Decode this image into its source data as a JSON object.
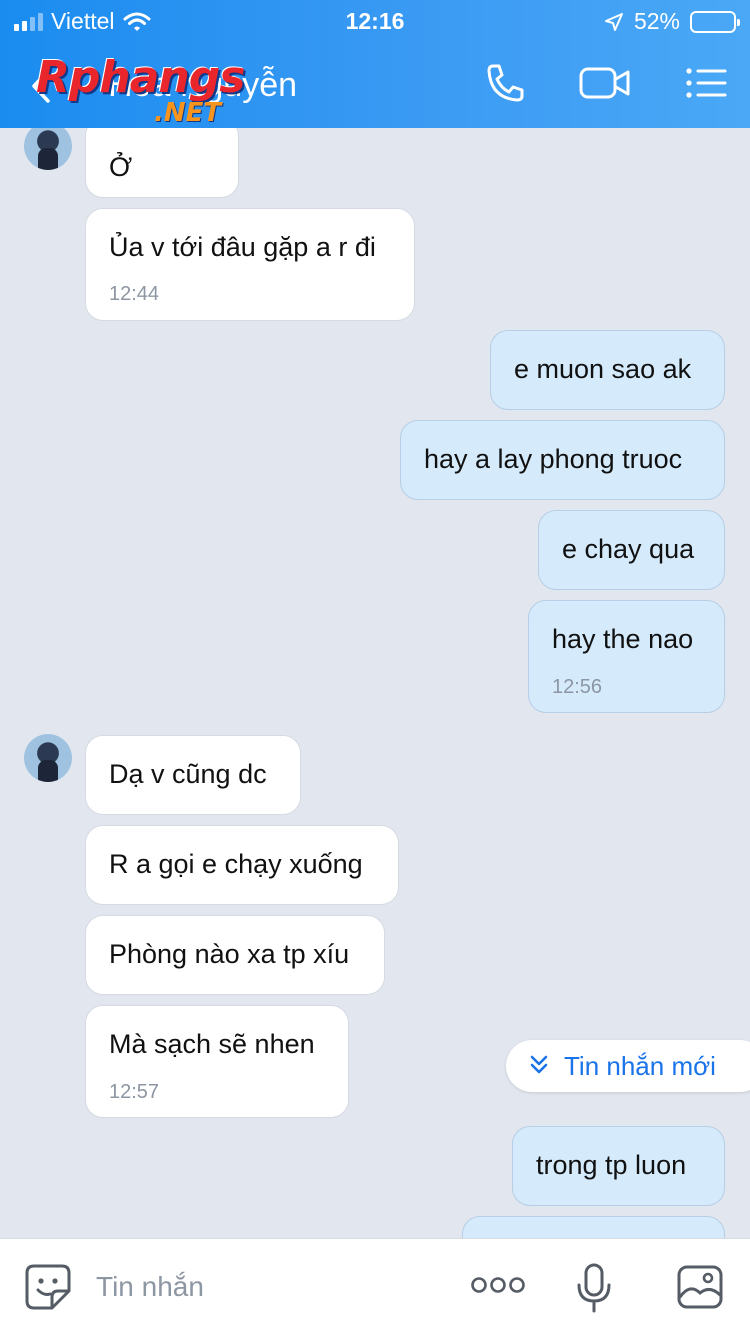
{
  "status_bar": {
    "carrier": "Viettel",
    "time": "12:16",
    "battery": "52%",
    "battery_level": 0.52
  },
  "header": {
    "back_icon": "chevron-left-icon",
    "contact_name": "Hoa Nguyễn",
    "logo": {
      "main": "Rphangs",
      "sub": ".NET"
    },
    "actions": [
      "phone-icon",
      "video-call-icon",
      "list-menu-icon"
    ]
  },
  "messages": [
    {
      "side": "in",
      "text": "Ở",
      "time": ""
    },
    {
      "side": "in",
      "text": "Ủa v tới đâu gặp a r đi",
      "time": "12:44"
    },
    {
      "side": "out",
      "text": "e muon sao ak",
      "time": ""
    },
    {
      "side": "out",
      "text": "hay a lay phong truoc",
      "time": ""
    },
    {
      "side": "out",
      "text": "e chay qua",
      "time": ""
    },
    {
      "side": "out",
      "text": "hay the nao",
      "time": "12:56"
    },
    {
      "side": "in",
      "text": "Dạ v cũng dc",
      "time": ""
    },
    {
      "side": "in",
      "text": "R a gọi e chạy xuống",
      "time": ""
    },
    {
      "side": "in",
      "text": "Phòng nào xa tp xíu",
      "time": ""
    },
    {
      "side": "in",
      "text": "Mà sạch sẽ nhen",
      "time": "12:57"
    },
    {
      "side": "out",
      "text": "trong tp luon",
      "time": ""
    }
  ],
  "new_message_pill": {
    "label": "Tin nhắn mới",
    "icon": "double-chevron-down-icon"
  },
  "composer": {
    "placeholder": "Tin nhắn",
    "icons": [
      "sticker-icon",
      "more-icon",
      "microphone-icon",
      "image-icon"
    ]
  },
  "colors": {
    "header": "#1a8cf0",
    "incoming_bubble": "#ffffff",
    "outgoing_bubble": "#d5ebfc",
    "chat_background": "#e2e6ee",
    "accent": "#1a73e8"
  }
}
